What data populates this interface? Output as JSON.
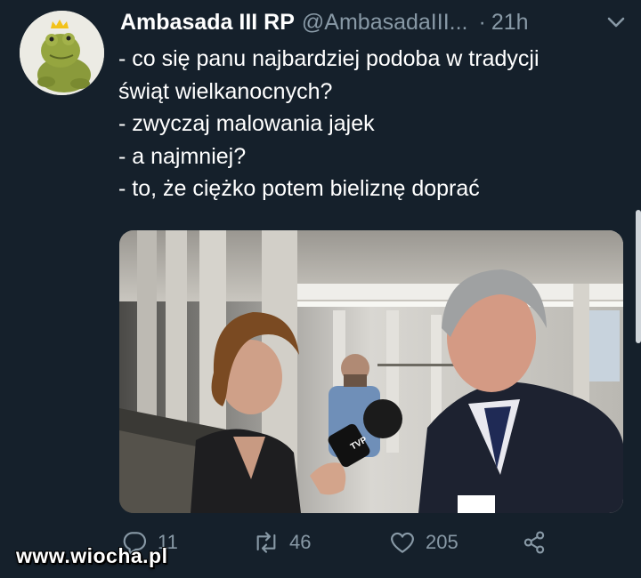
{
  "tweet": {
    "author_name": "Ambasada III RP",
    "handle": "@AmbasadaIII...",
    "separator": "·",
    "time": "21h",
    "lines": [
      "- co się panu najbardziej podoba w tradycji",
      "świąt wielkanocnych?",
      "- zwyczaj malowania jajek",
      "- a najmniej?",
      "- to, że ciężko potem bieliznę doprać"
    ]
  },
  "actions": {
    "reply_count": "11",
    "retweet_count": "46",
    "like_count": "205"
  },
  "icons": {
    "avatar": "frog-with-crown-avatar",
    "menu": "chevron-down-icon",
    "reply": "reply-icon",
    "retweet": "retweet-icon",
    "like": "heart-icon",
    "share": "share-icon",
    "mic": "microphone-icon"
  },
  "colors": {
    "background": "#15202b",
    "secondary_text": "#8899a6"
  },
  "watermark": "www.wiocha.pl"
}
